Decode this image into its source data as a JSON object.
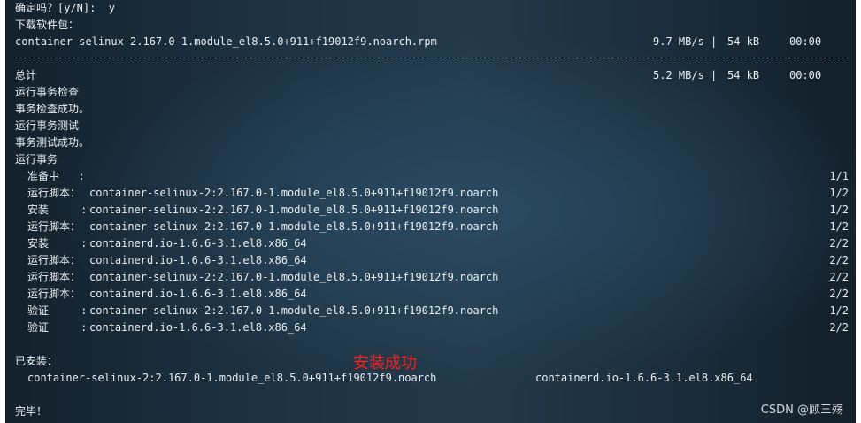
{
  "terminal": {
    "confirm_line": "确定吗？[y/N]:  y",
    "download_heading": "下载软件包：",
    "download": {
      "file": "container-selinux-2.167.0-1.module_el8.5.0+911+f19012f9.noarch.rpm",
      "speed": "9.7 MB/s |",
      "size": "54 kB",
      "time": "00:00"
    },
    "total": {
      "label": "总计",
      "speed": "5.2 MB/s |",
      "size": "54 kB",
      "time": "00:00"
    },
    "status_lines": [
      "运行事务检查",
      "事务检查成功。",
      "运行事务测试",
      "事务测试成功。",
      "运行事务"
    ],
    "tx_items": [
      {
        "action": "准备中   :",
        "pkg": "",
        "progress": "1/1"
      },
      {
        "action": "运行脚本：",
        "pkg": "container-selinux-2:2.167.0-1.module_el8.5.0+911+f19012f9.noarch",
        "progress": "1/2"
      },
      {
        "action": "安装     :",
        "pkg": "container-selinux-2:2.167.0-1.module_el8.5.0+911+f19012f9.noarch",
        "progress": "1/2"
      },
      {
        "action": "运行脚本：",
        "pkg": "container-selinux-2:2.167.0-1.module_el8.5.0+911+f19012f9.noarch",
        "progress": "1/2"
      },
      {
        "action": "安装     :",
        "pkg": "containerd.io-1.6.6-3.1.el8.x86_64",
        "progress": "2/2"
      },
      {
        "action": "运行脚本：",
        "pkg": "containerd.io-1.6.6-3.1.el8.x86_64",
        "progress": "2/2"
      },
      {
        "action": "运行脚本：",
        "pkg": "container-selinux-2:2.167.0-1.module_el8.5.0+911+f19012f9.noarch",
        "progress": "2/2"
      },
      {
        "action": "运行脚本：",
        "pkg": "containerd.io-1.6.6-3.1.el8.x86_64",
        "progress": "2/2"
      },
      {
        "action": "验证     :",
        "pkg": "container-selinux-2:2.167.0-1.module_el8.5.0+911+f19012f9.noarch",
        "progress": "1/2"
      },
      {
        "action": "验证     :",
        "pkg": "containerd.io-1.6.6-3.1.el8.x86_64",
        "progress": "2/2"
      }
    ],
    "installed_heading": "已安装：",
    "installed": [
      "container-selinux-2:2.167.0-1.module_el8.5.0+911+f19012f9.noarch",
      "containerd.io-1.6.6-3.1.el8.x86_64"
    ],
    "done": "完毕！"
  },
  "annotation": "安装成功",
  "watermark": "CSDN @顾三殇"
}
